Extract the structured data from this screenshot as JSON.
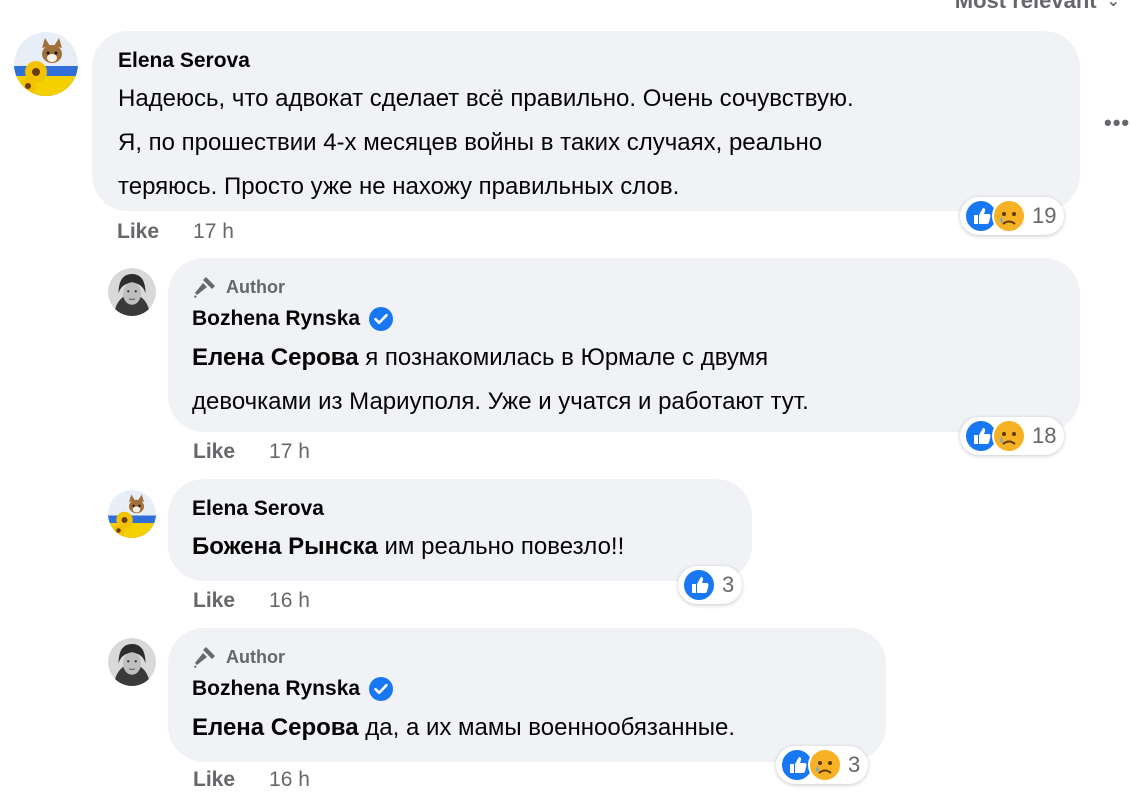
{
  "sort": {
    "label": "Most relevant"
  },
  "colors": {
    "like_blue": "#1877f2",
    "verified_blue": "#1877f2",
    "bubble_bg": "#f0f2f5",
    "meta_gray": "#65676b"
  },
  "comments": [
    {
      "author": "Elena Serova",
      "author_badge": "",
      "lines": [
        "Надеюсь, что адвокат сделает всё правильно. Очень сочувствую.",
        "Я, по прошествии 4-х месяцев войны в таких случаях, реально",
        "теряюсь. Просто уже не нахожу правильных слов."
      ],
      "like_label": "Like",
      "time": "17 h",
      "reaction_count": "19",
      "more_label": "•••"
    },
    {
      "author": "Bozhena Rynska",
      "author_badge": "Author",
      "mention": "Елена Серова",
      "lines": [
        " я познакомилась в Юрмале с двумя",
        "девочками из Мариуполя. Уже и учатся и работают тут."
      ],
      "like_label": "Like",
      "time": "17 h",
      "reaction_count": "18"
    },
    {
      "author": "Elena Serova",
      "mention": "Божена Рынска",
      "lines": [
        " им реально повезло!!"
      ],
      "like_label": "Like",
      "time": "16 h",
      "reaction_count": "3"
    },
    {
      "author": "Bozhena Rynska",
      "author_badge": "Author",
      "mention": "Елена Серова",
      "lines": [
        " да, а их мамы военнообязанные."
      ],
      "like_label": "Like",
      "time": "16 h",
      "reaction_count": "3"
    }
  ]
}
